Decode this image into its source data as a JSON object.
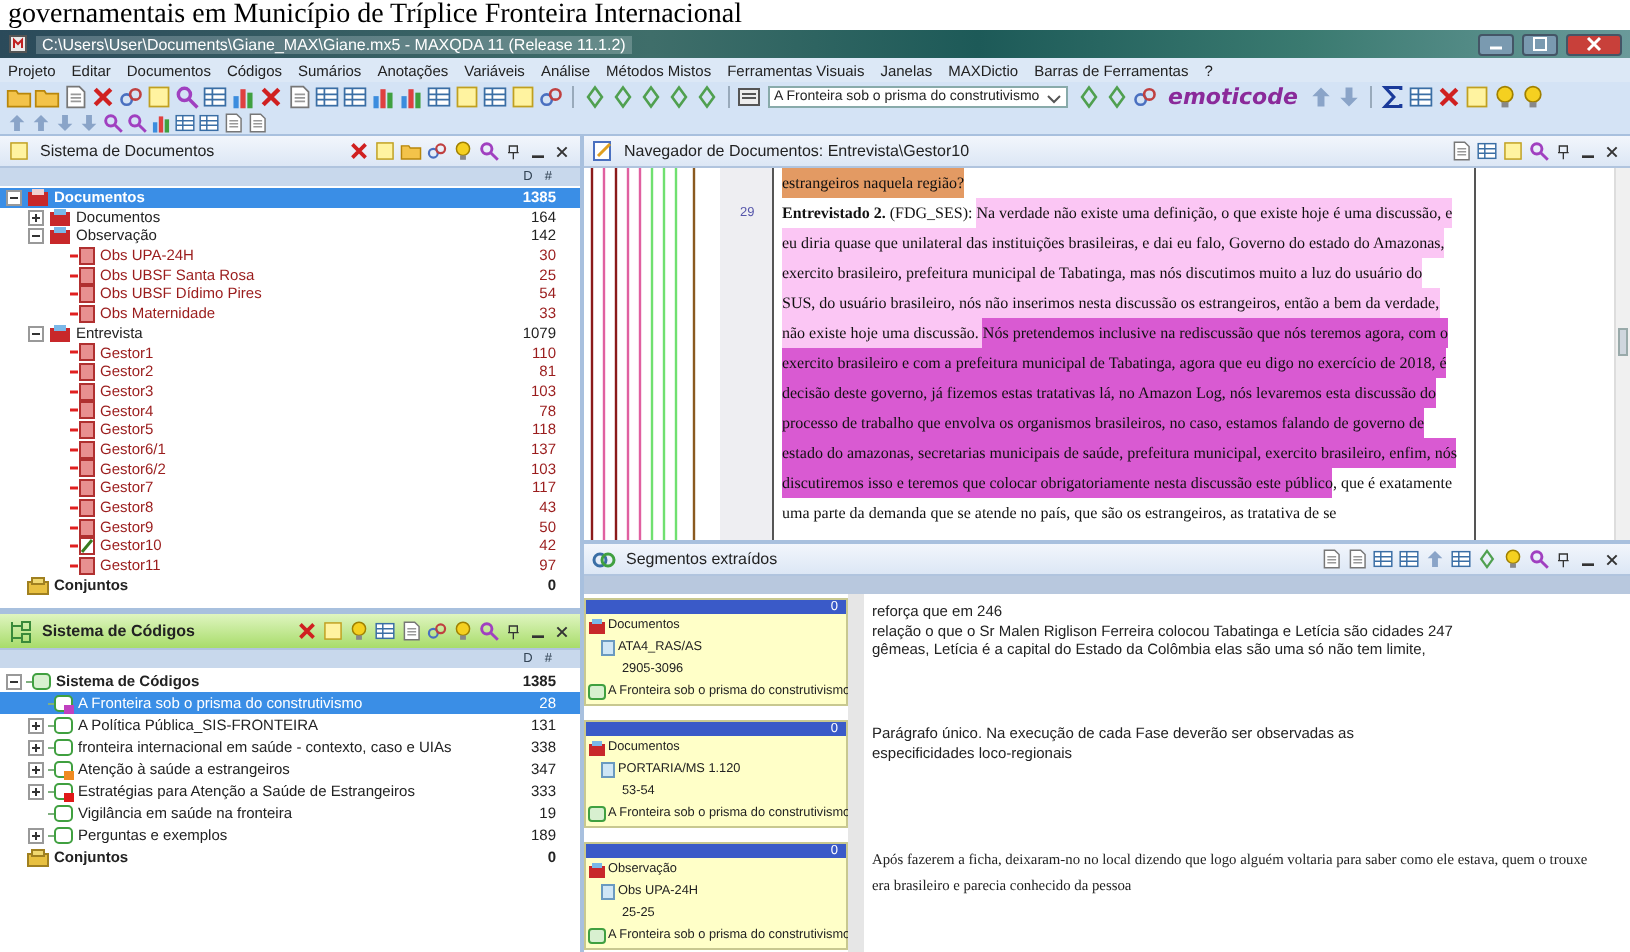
{
  "doc_heading": "governamentais em Município de Tríplice Fronteira Internacional",
  "window": {
    "title": "C:\\Users\\User\\Documents\\Giane_MAX\\Giane.mx5 - MAXQDA 11  (Release 11.1.2)"
  },
  "menu": [
    "Projeto",
    "Editar",
    "Documentos",
    "Códigos",
    "Sumários",
    "Anotações",
    "Variáveis",
    "Análise",
    "Métodos Mistos",
    "Ferramentas Visuais",
    "Janelas",
    "MAXDictio",
    "Barras de Ferramentas",
    "?"
  ],
  "toolbar": {
    "code_dropdown": {
      "value": "A Fronteira sob o prisma do construtivismo"
    },
    "logo": "emoticode"
  },
  "documents_panel": {
    "title": "Sistema de Documentos",
    "columns": [
      "D",
      "#"
    ],
    "tree": [
      {
        "label": "Documentos",
        "count": "1385",
        "kind": "root",
        "selected": true,
        "expanded": true,
        "children": [
          {
            "label": "Documentos",
            "count": "164",
            "kind": "group",
            "selected": false,
            "expanded": false
          },
          {
            "label": "Observação",
            "count": "142",
            "kind": "group",
            "selected": false,
            "expanded": true,
            "children": [
              {
                "label": "Obs UPA-24H",
                "count": "30",
                "kind": "document",
                "selected": false,
                "open": false
              },
              {
                "label": "Obs UBSF Santa Rosa",
                "count": "25",
                "kind": "document",
                "selected": false,
                "open": false
              },
              {
                "label": "Obs UBSF Dídimo Pires",
                "count": "54",
                "kind": "document",
                "selected": false,
                "open": false
              },
              {
                "label": "Obs Maternidade",
                "count": "33",
                "kind": "document",
                "selected": false,
                "open": false
              }
            ]
          },
          {
            "label": "Entrevista",
            "count": "1079",
            "kind": "group",
            "selected": false,
            "expanded": true,
            "children": [
              {
                "label": "Gestor1",
                "count": "110",
                "kind": "document",
                "selected": false,
                "open": false
              },
              {
                "label": "Gestor2",
                "count": "81",
                "kind": "document",
                "selected": false,
                "open": false
              },
              {
                "label": "Gestor3",
                "count": "103",
                "kind": "document",
                "selected": false,
                "open": false
              },
              {
                "label": "Gestor4",
                "count": "78",
                "kind": "document",
                "selected": false,
                "open": false
              },
              {
                "label": "Gestor5",
                "count": "118",
                "kind": "document",
                "selected": false,
                "open": false
              },
              {
                "label": "Gestor6/1",
                "count": "137",
                "kind": "document",
                "selected": false,
                "open": false
              },
              {
                "label": "Gestor6/2",
                "count": "103",
                "kind": "document",
                "selected": false,
                "open": false
              },
              {
                "label": "Gestor7",
                "count": "117",
                "kind": "document",
                "selected": false,
                "open": false
              },
              {
                "label": "Gestor8",
                "count": "43",
                "kind": "document",
                "selected": false,
                "open": false
              },
              {
                "label": "Gestor9",
                "count": "50",
                "kind": "document",
                "selected": false,
                "open": false
              },
              {
                "label": "Gestor10",
                "count": "42",
                "kind": "document",
                "selected": false,
                "open": true
              },
              {
                "label": "Gestor11",
                "count": "97",
                "kind": "document",
                "selected": false,
                "open": false
              }
            ]
          }
        ]
      },
      {
        "label": "Conjuntos",
        "count": "0",
        "kind": "sets",
        "selected": false
      }
    ]
  },
  "navigator": {
    "title": "Navegador de Documentos: Entrevista\\Gestor10",
    "paragraphs": [
      {
        "segments": [
          {
            "text": "estrangeiros naquela região?",
            "color": "#e39a63"
          }
        ]
      },
      {
        "line_number": "29",
        "segments": [
          {
            "text": "**Entrevistado 2.** (FDG_SES): "
          },
          {
            "text": "Na verdade não existe uma definição, o que existe hoje é uma discussão, e eu diria quase que unilateral das instituições brasileiras, e dai eu falo, Governo do estado do Amazonas, exercito brasileiro, prefeitura municipal de Tabatinga, mas nós discutimos muito a luz do usuário do SUS, do usuário brasileiro, nós não inserimos nesta discussão os estrangeiros, então a bem da verdade, não existe hoje uma discussão. ",
            "color": "#fbc6f4"
          },
          {
            "text": "Nós pretendemos inclusive na rediscussão que nós teremos agora, com o exercito brasileiro e com a prefeitura municipal de Tabatinga, agora que eu digo no exercício de 2018, é decisão deste governo, já fizemos estas tratativas lá, no Amazon Log, nós levaremos esta discussão do processo de trabalho que envolva os organismos brasileiros, no caso, estamos falando de governo de estado do amazonas, secretarias municipais de saúde, prefeitura municipal, exercito brasileiro, enfim, nós discutiremos isso e teremos que colocar obrigatoriamente nesta discussão este público",
            "color": "#d95ad2"
          },
          {
            "text": ", que é exatamente uma parte da demanda que se atende no país, que são os estrangeiros, as tratativa de se"
          }
        ]
      }
    ]
  },
  "codes_panel": {
    "title": "Sistema de Códigos",
    "columns": [
      "D",
      "#"
    ],
    "tree": [
      {
        "label": "Sistema de Códigos",
        "count": "1385",
        "kind": "root",
        "selected": false,
        "expanded": true,
        "children": [
          {
            "label": "A Fronteira sob o prisma do construtivismo",
            "count": "28",
            "kind": "code",
            "selected": true,
            "color": "#c040c0"
          },
          {
            "label": "A Política Pública_SIS-FRONTEIRA",
            "count": "131",
            "kind": "code",
            "selected": false,
            "expanded": false
          },
          {
            "label": "fronteira internacional em saúde - contexto, caso e UIAs",
            "count": "338",
            "kind": "code",
            "selected": false,
            "expanded": false
          },
          {
            "label": "Atenção à saúde a estrangeiros",
            "count": "347",
            "kind": "code",
            "selected": false,
            "expanded": false,
            "color": "#f08a20"
          },
          {
            "label": "Estratégias para Atenção a Saúde de Estrangeiros",
            "count": "333",
            "kind": "code",
            "selected": false,
            "expanded": false,
            "color": "#e01818"
          },
          {
            "label": "Vigilância em saúde na fronteira",
            "count": "19",
            "kind": "code",
            "selected": false
          },
          {
            "label": "Perguntas e exemplos",
            "count": "189",
            "kind": "code",
            "selected": false,
            "expanded": false
          }
        ]
      },
      {
        "label": "Conjuntos",
        "count": "0",
        "kind": "sets",
        "selected": false
      }
    ]
  },
  "segments_panel": {
    "title": "Segmentos extraídos",
    "segments": [
      {
        "count": "0",
        "group": "Documentos",
        "document": "ATA4_RAS/AS",
        "position": "2905-3096",
        "code": "A Fronteira sob o prisma do construtivismo",
        "kind": "sans",
        "lines": [
          "reforça que em 246",
          "relação o que o Sr Malen Riglison Ferreira colocou Tabatinga e Letícia são cidades 247",
          "gêmeas, Letícia é a capital do Estado da Colômbia elas são uma só não tem limite,"
        ]
      },
      {
        "count": "0",
        "group": "Documentos",
        "document": "PORTARIA/MS 1.120",
        "position": "53-54",
        "code": "A Fronteira sob o prisma do construtivismo",
        "kind": "sans",
        "lines": [
          "Parágrafo único. Na execução de cada Fase deverão ser observadas as",
          "especificidades loco-regionais"
        ]
      },
      {
        "count": "0",
        "group": "Observação",
        "document": "Obs UPA-24H",
        "position": "25-25",
        "code": "A Fronteira sob o prisma do construtivismo",
        "kind": "serif",
        "lines": [
          "Após fazerem a ficha, deixaram-no no local dizendo que logo alguém voltaria para saber como ele estava, quem o trouxe",
          "era brasileiro e parecia conhecido da pessoa"
        ]
      }
    ]
  }
}
